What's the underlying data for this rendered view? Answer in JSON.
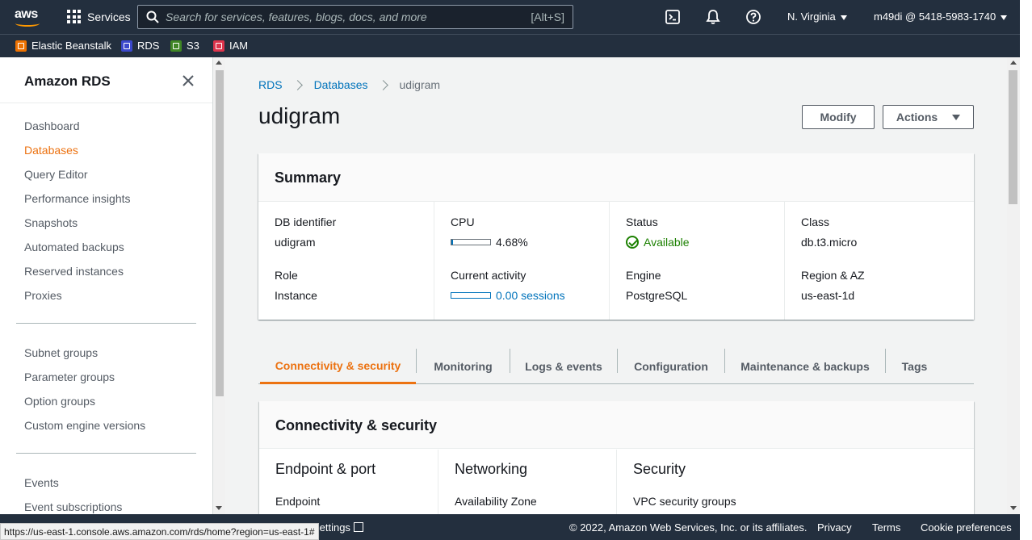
{
  "topnav": {
    "logo": "aws",
    "services_label": "Services",
    "search_placeholder": "Search for services, features, blogs, docs, and more",
    "search_shortcut": "[Alt+S]",
    "region": "N. Virginia",
    "account": "m49di @ 5418-5983-1740",
    "icons": [
      "grid-icon",
      "search-icon",
      "cloudshell-icon",
      "bell-icon",
      "help-icon"
    ]
  },
  "favorites": [
    {
      "label": "Elastic Beanstalk",
      "color": "#ed7100"
    },
    {
      "label": "RDS",
      "color": "#3b48cc"
    },
    {
      "label": "S3",
      "color": "#3f8624"
    },
    {
      "label": "IAM",
      "color": "#dd344c"
    }
  ],
  "sidebar": {
    "title": "Amazon RDS",
    "group1": [
      "Dashboard",
      "Databases",
      "Query Editor",
      "Performance insights",
      "Snapshots",
      "Automated backups",
      "Reserved instances",
      "Proxies"
    ],
    "group2": [
      "Subnet groups",
      "Parameter groups",
      "Option groups",
      "Custom engine versions"
    ],
    "group3": [
      "Events",
      "Event subscriptions"
    ],
    "active": "Databases"
  },
  "breadcrumb": [
    "RDS",
    "Databases",
    "udigram"
  ],
  "page": {
    "title": "udigram",
    "modify_label": "Modify",
    "actions_label": "Actions"
  },
  "summary": {
    "title": "Summary",
    "db_identifier_label": "DB identifier",
    "db_identifier": "udigram",
    "role_label": "Role",
    "role": "Instance",
    "cpu_label": "CPU",
    "cpu": "4.68%",
    "cpu_fraction": 0.0468,
    "activity_label": "Current activity",
    "activity": "0.00 sessions",
    "status_label": "Status",
    "status": "Available",
    "engine_label": "Engine",
    "engine": "PostgreSQL",
    "class_label": "Class",
    "class": "db.t3.micro",
    "region_az_label": "Region & AZ",
    "region_az": "us-east-1d"
  },
  "tabs": [
    "Connectivity & security",
    "Monitoring",
    "Logs & events",
    "Configuration",
    "Maintenance & backups",
    "Tags"
  ],
  "connectivity": {
    "title": "Connectivity & security",
    "endpoint_heading": "Endpoint & port",
    "endpoint_label": "Endpoint",
    "networking_heading": "Networking",
    "az_label": "Availability Zone",
    "security_heading": "Security",
    "vpc_sg_label": "VPC security groups"
  },
  "footer": {
    "settings": "ied Settings",
    "copyright": "© 2022, Amazon Web Services, Inc. or its affiliates.",
    "privacy": "Privacy",
    "terms": "Terms",
    "cookie": "Cookie preferences"
  },
  "status_url": "https://us-east-1.console.aws.amazon.com/rds/home?region=us-east-1#"
}
